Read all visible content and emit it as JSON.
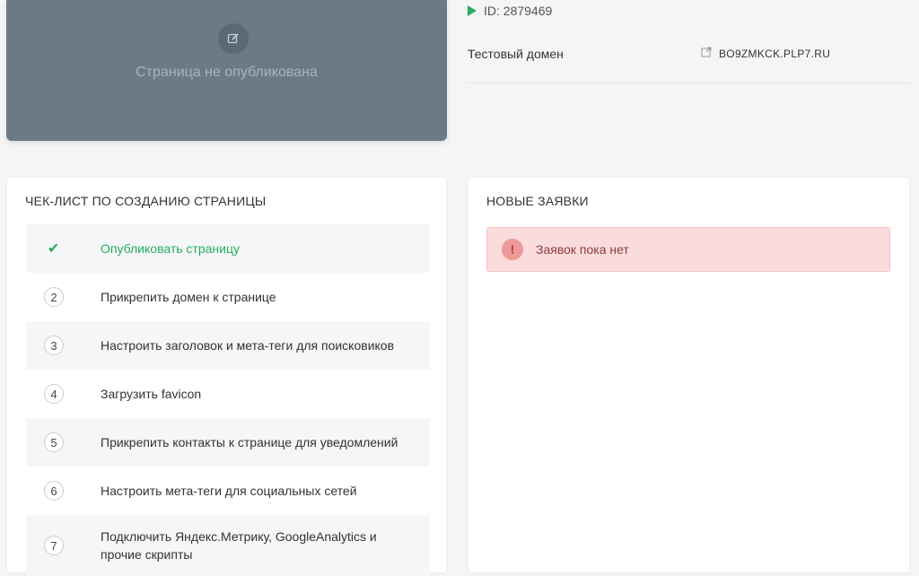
{
  "preview": {
    "icon": "edit-icon",
    "status_text": "Страница не опубликована"
  },
  "info": {
    "id_text": "ID: 2879469",
    "domain_label": "Тестовый домен",
    "domain_value": "BO9ZMKCK.PLP7.RU"
  },
  "checklist": {
    "title": "ЧЕК-ЛИСТ ПО СОЗДАНИЮ СТРАНИЦЫ",
    "items": [
      {
        "num": "",
        "label": "Опубликовать страницу",
        "done": true
      },
      {
        "num": "2",
        "label": "Прикрепить домен к странице",
        "done": false
      },
      {
        "num": "3",
        "label": "Настроить заголовок и мета-теги для поисковиков",
        "done": false
      },
      {
        "num": "4",
        "label": "Загрузить favicon",
        "done": false
      },
      {
        "num": "5",
        "label": "Прикрепить контакты к странице для уведомлений",
        "done": false
      },
      {
        "num": "6",
        "label": "Настроить мета-теги для социальных сетей",
        "done": false
      },
      {
        "num": "7",
        "label": "Подключить Яндекс.Метрику, GoogleAnalytics и прочие скрипты",
        "done": false
      }
    ]
  },
  "requests": {
    "title": "НОВЫЕ ЗАЯВКИ",
    "alert_icon": "!",
    "alert_text": "Заявок пока нет"
  },
  "colors": {
    "accent_green": "#27ae60",
    "alert_bg": "#fbdcdc",
    "preview_bg": "#6b7b86"
  }
}
